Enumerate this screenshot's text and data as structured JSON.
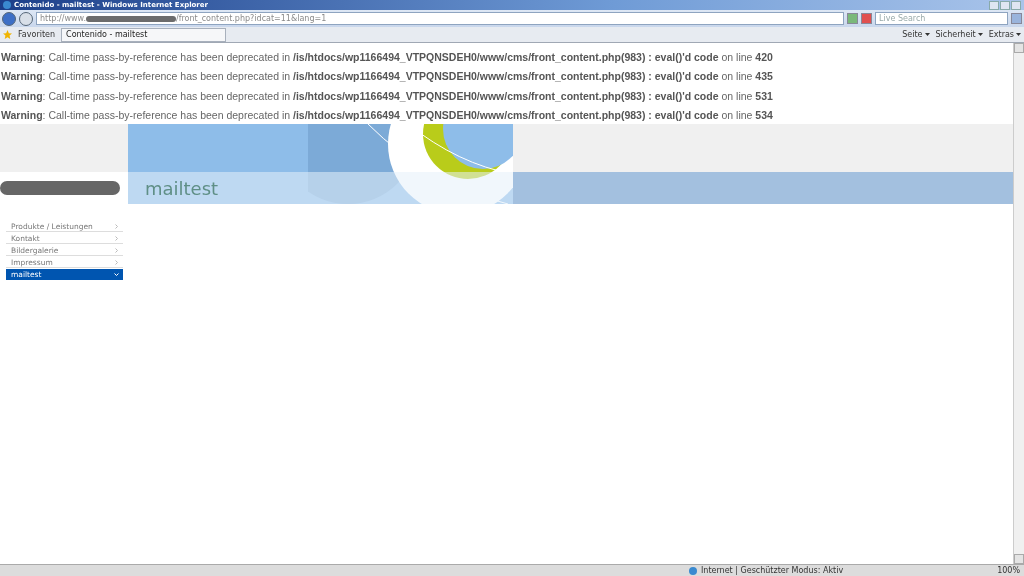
{
  "window": {
    "title": "Contenido - mailtest - Windows Internet Explorer"
  },
  "address_bar": {
    "url_start": "http://www.",
    "url_end": "/front_content.php?idcat=11&lang=1",
    "search_placeholder": "Live Search"
  },
  "favorites_bar": {
    "favorites": "Favoriten",
    "tab": "Contenido - mailtest",
    "commands": [
      "Seite",
      "Sicherheit",
      "Extras"
    ]
  },
  "warnings": [
    "**Warning**: Call-time pass-by-reference has been deprecated in **/is/htdocs/wp1166494_VTPQNSDEH0/www/cms/front_content.php(983) : eval()'d code** on line **420**",
    "**Warning**: Call-time pass-by-reference has been deprecated in **/is/htdocs/wp1166494_VTPQNSDEH0/www/cms/front_content.php(983) : eval()'d code** on line **435**",
    "**Warning**: Call-time pass-by-reference has been deprecated in **/is/htdocs/wp1166494_VTPQNSDEH0/www/cms/front_content.php(983) : eval()'d code** on line **531**",
    "**Warning**: Call-time pass-by-reference has been deprecated in **/is/htdocs/wp1166494_VTPQNSDEH0/www/cms/front_content.php(983) : eval()'d code** on line **534**"
  ],
  "header": {
    "page_title": "mailtest"
  },
  "nav": [
    {
      "label": "Produkte / Leistungen",
      "selected": false
    },
    {
      "label": "Kontakt",
      "selected": false
    },
    {
      "label": "Bildergalerie",
      "selected": false
    },
    {
      "label": "Impressum",
      "selected": false
    },
    {
      "label": "mailtest",
      "selected": true
    }
  ],
  "status_bar": {
    "zone": "Internet | Geschützter Modus: Aktiv",
    "zoom": "100%"
  }
}
